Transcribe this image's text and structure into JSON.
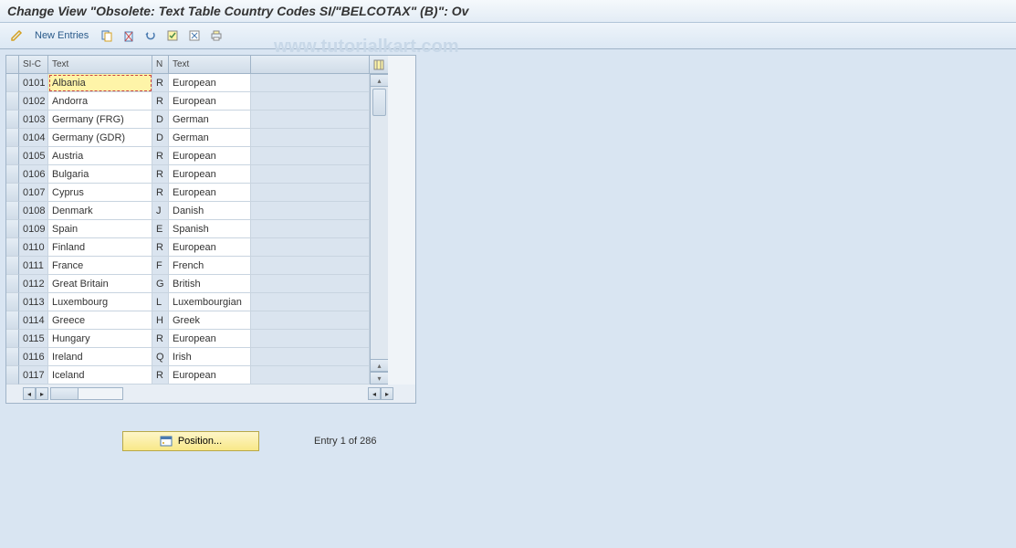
{
  "title": "Change View \"Obsolete: Text Table Country Codes SI/\"BELCOTAX\" (B)\": Ov",
  "toolbar": {
    "new_entries": "New Entries"
  },
  "cols": {
    "selector": "",
    "sic": "SI-C",
    "text": "Text",
    "n": "N",
    "text2": "Text"
  },
  "rows": [
    {
      "sic": "0101",
      "text": "Albania",
      "n": "R",
      "cat": "European",
      "focused": true
    },
    {
      "sic": "0102",
      "text": "Andorra",
      "n": "R",
      "cat": "European"
    },
    {
      "sic": "0103",
      "text": "Germany (FRG)",
      "n": "D",
      "cat": "German"
    },
    {
      "sic": "0104",
      "text": "Germany (GDR)",
      "n": "D",
      "cat": "German"
    },
    {
      "sic": "0105",
      "text": "Austria",
      "n": "R",
      "cat": "European"
    },
    {
      "sic": "0106",
      "text": "Bulgaria",
      "n": "R",
      "cat": "European"
    },
    {
      "sic": "0107",
      "text": "Cyprus",
      "n": "R",
      "cat": "European"
    },
    {
      "sic": "0108",
      "text": "Denmark",
      "n": "J",
      "cat": "Danish"
    },
    {
      "sic": "0109",
      "text": "Spain",
      "n": "E",
      "cat": "Spanish"
    },
    {
      "sic": "0110",
      "text": "Finland",
      "n": "R",
      "cat": "European"
    },
    {
      "sic": "0111",
      "text": "France",
      "n": "F",
      "cat": "French"
    },
    {
      "sic": "0112",
      "text": "Great Britain",
      "n": "G",
      "cat": "British"
    },
    {
      "sic": "0113",
      "text": "Luxembourg",
      "n": "L",
      "cat": "Luxembourgian"
    },
    {
      "sic": "0114",
      "text": "Greece",
      "n": "H",
      "cat": "Greek"
    },
    {
      "sic": "0115",
      "text": "Hungary",
      "n": "R",
      "cat": "European"
    },
    {
      "sic": "0116",
      "text": "Ireland",
      "n": "Q",
      "cat": "Irish"
    },
    {
      "sic": "0117",
      "text": "Iceland",
      "n": "R",
      "cat": "European"
    }
  ],
  "footer": {
    "position_btn": "Position...",
    "entry_count": "Entry 1 of 286"
  },
  "watermark": "www.tutorialkart.com"
}
